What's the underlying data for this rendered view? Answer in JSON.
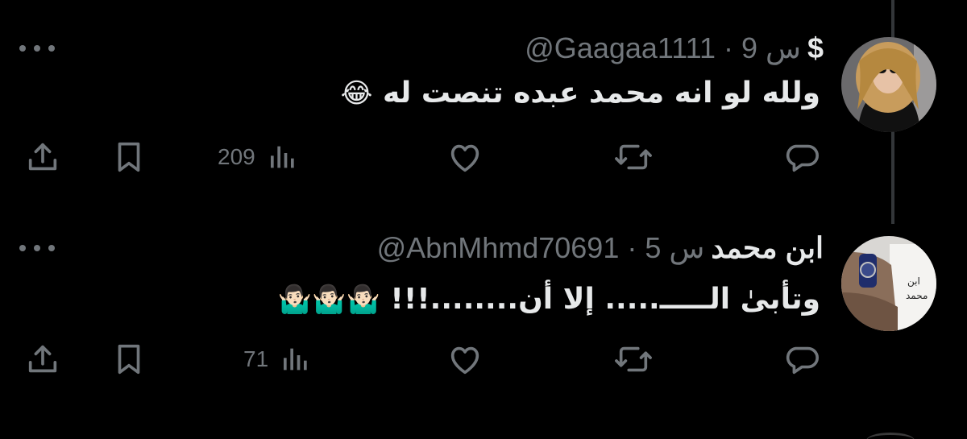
{
  "replies": [
    {
      "display_name": "$",
      "handle_time": "@Gaagaa1111 · 9 س",
      "text": "ولله لو انه محمد عبده تنصت له",
      "emoji": "😂",
      "views": "209",
      "avatar": "woman-sunglasses-avatar"
    },
    {
      "display_name": "ابن محمد",
      "handle_time": "@AbnMhmd70691 · 5 س",
      "text": "وتأبىٰ الـــــ..... إلا أن........!!!",
      "emoji": "🤷🏻‍♂️🤷🏻‍♂️🤷🏻‍♂️",
      "views": "71",
      "avatar": "hand-watch-note-avatar"
    }
  ],
  "icons": [
    "share-icon",
    "bookmark-icon",
    "views-icon",
    "like-icon",
    "retweet-icon",
    "reply-icon",
    "more-icon"
  ],
  "colors": {
    "background": "#000000",
    "text": "#e7e9ea",
    "muted": "#71767b",
    "thread_line": "#333639"
  }
}
